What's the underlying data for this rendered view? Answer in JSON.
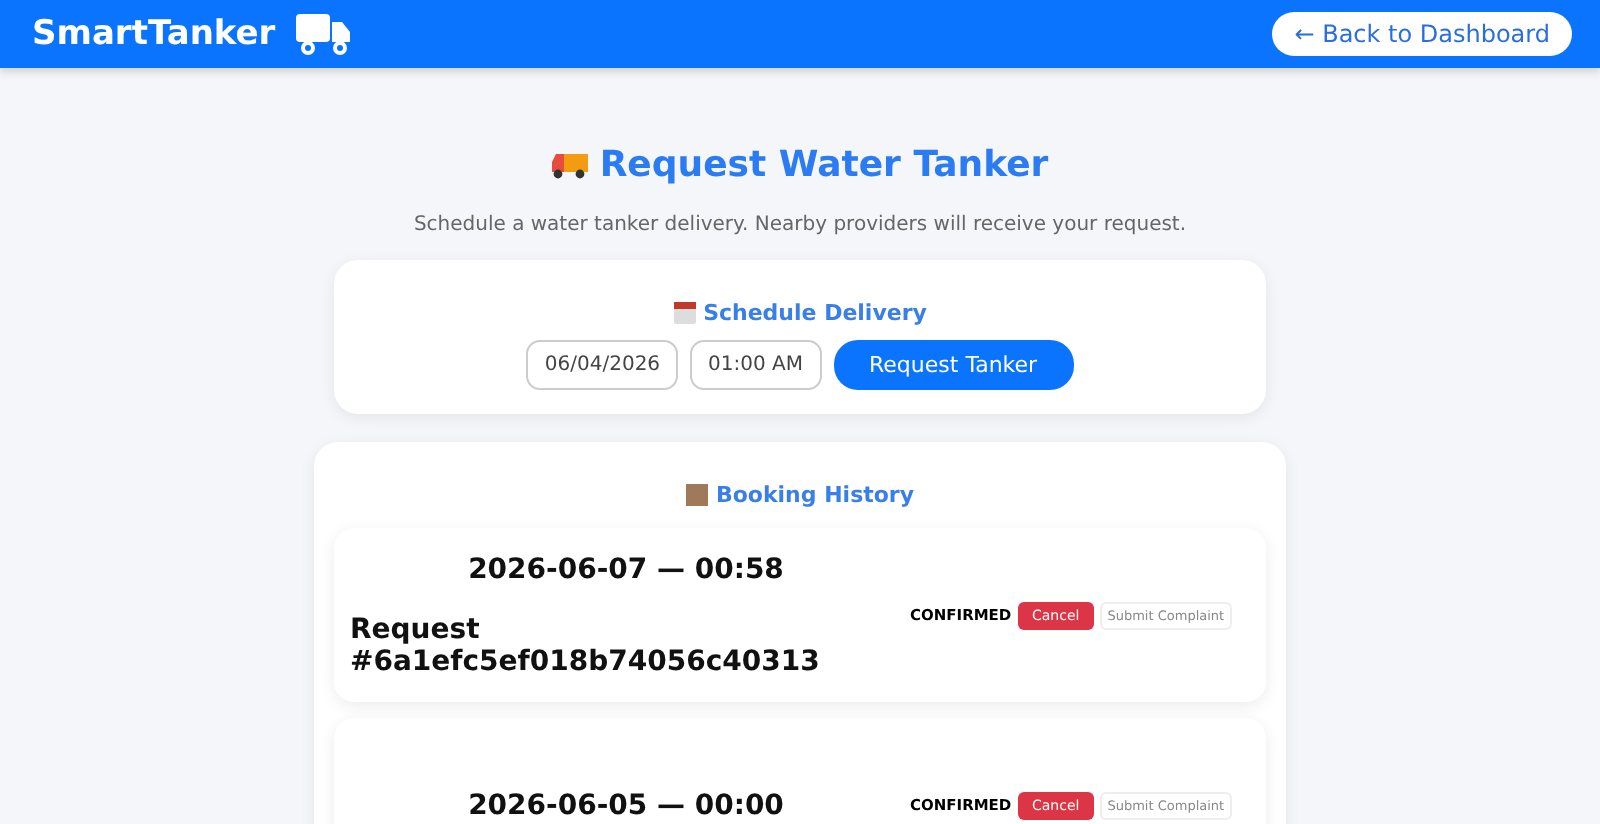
{
  "header": {
    "brand": "SmartTanker",
    "back_button": "← Back to Dashboard"
  },
  "page": {
    "title": "Request Water Tanker",
    "subtitle": "Schedule a water tanker delivery. Nearby providers will receive your request."
  },
  "schedule": {
    "heading": "Schedule Delivery",
    "date": "06/04/2026",
    "time": "01:00 AM",
    "submit": "Request Tanker"
  },
  "history": {
    "heading": "Booking History",
    "bookings": [
      {
        "datetime": "2026-06-07 — 00:58",
        "request": "Request #6a1efc5ef018b74056c40313",
        "status": "CONFIRMED",
        "cancel": "Cancel",
        "complaint": "Submit Complaint"
      },
      {
        "datetime": "2026-06-05 — 00:00",
        "status": "CONFIRMED",
        "cancel": "Cancel",
        "complaint": "Submit Complaint"
      }
    ]
  }
}
